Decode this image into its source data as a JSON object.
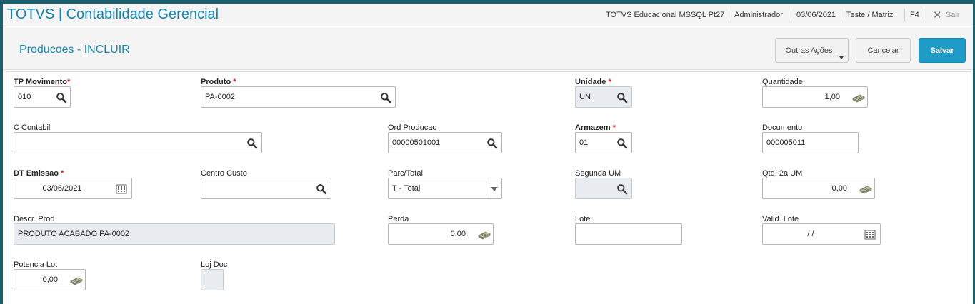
{
  "app": {
    "title": "TOTVS | Contabilidade Gerencial",
    "environment": "TOTVS Educacional MSSQL Pt27",
    "user": "Administrador",
    "date": "03/06/2021",
    "branch": "Teste / Matriz",
    "shortcut": "F4",
    "exit_label": "Sair"
  },
  "page": {
    "title": "Producoes - INCLUIR",
    "actions": {
      "more_label": "Outras Ações",
      "cancel_label": "Cancelar",
      "save_label": "Salvar"
    }
  },
  "form": {
    "tp_movimento": {
      "label": "TP Movimento",
      "required": "*",
      "value": "010"
    },
    "produto": {
      "label": "Produto",
      "required": "*",
      "value": "PA-0002"
    },
    "unidade": {
      "label": "Unidade",
      "required": "*",
      "value": "UN"
    },
    "quantidade": {
      "label": "Quantidade",
      "value": "1,00"
    },
    "c_contabil": {
      "label": "C Contabil",
      "value": ""
    },
    "ord_producao": {
      "label": "Ord Producao",
      "value": "00000501001"
    },
    "armazem": {
      "label": "Armazem",
      "required": "*",
      "value": "01"
    },
    "documento": {
      "label": "Documento",
      "value": "000005011"
    },
    "dt_emissao": {
      "label": "DT Emissao",
      "required": "*",
      "value": "03/06/2021"
    },
    "centro_custo": {
      "label": "Centro Custo",
      "value": ""
    },
    "parc_total": {
      "label": "Parc/Total",
      "value": "T - Total"
    },
    "segunda_um": {
      "label": "Segunda UM",
      "value": ""
    },
    "qtd_2a_um": {
      "label": "Qtd. 2a UM",
      "value": "0,00"
    },
    "descr_prod": {
      "label": "Descr. Prod",
      "value": "PRODUTO ACABADO PA-0002"
    },
    "perda": {
      "label": "Perda",
      "value": "0,00"
    },
    "lote": {
      "label": "Lote",
      "value": ""
    },
    "valid_lote": {
      "label": "Valid. Lote",
      "value": "/ /"
    },
    "potencia_lot": {
      "label": "Potencia Lot",
      "value": "0,00"
    },
    "loj_doc": {
      "label": "Loj Doc",
      "value": ""
    }
  },
  "colors": {
    "brand": "#1487b4",
    "accent_button": "#1e9bc7",
    "frame": "#1a5f6e",
    "required": "#e02020",
    "readonly_field": "#e8ebef"
  },
  "icons": {
    "lookup": "search-icon",
    "numeric": "calculator-icon",
    "date": "calendar-icon",
    "close": "close-icon",
    "dropdown": "chevron-down-icon"
  }
}
